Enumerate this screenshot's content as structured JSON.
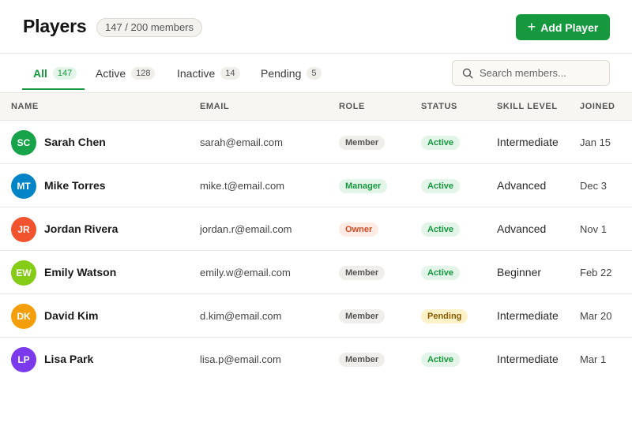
{
  "header": {
    "title": "Players",
    "member_count": "147 / 200 members",
    "add_button": "Add Player"
  },
  "tabs": [
    {
      "label": "All",
      "count": "147",
      "active": true
    },
    {
      "label": "Active",
      "count": "128",
      "active": false
    },
    {
      "label": "Inactive",
      "count": "14",
      "active": false
    },
    {
      "label": "Pending",
      "count": "5",
      "active": false
    }
  ],
  "search": {
    "placeholder": "Search members...",
    "value": ""
  },
  "table": {
    "columns": [
      "NAME",
      "EMAIL",
      "ROLE",
      "STATUS",
      "SKILL LEVEL",
      "JOINED"
    ],
    "rows": [
      {
        "initials": "SC",
        "avatar_color": "#16a34a",
        "name": "Sarah Chen",
        "email": "sarah@email.com",
        "role": "Member",
        "status": "Active",
        "skill": "Intermediate",
        "joined": "Jan 15"
      },
      {
        "initials": "MT",
        "avatar_color": "#0284c7",
        "name": "Mike Torres",
        "email": "mike.t@email.com",
        "role": "Manager",
        "status": "Active",
        "skill": "Advanced",
        "joined": "Dec 3"
      },
      {
        "initials": "JR",
        "avatar_color": "#f0532d",
        "name": "Jordan Rivera",
        "email": "jordan.r@email.com",
        "role": "Owner",
        "status": "Active",
        "skill": "Advanced",
        "joined": "Nov 1"
      },
      {
        "initials": "EW",
        "avatar_color": "#84cc16",
        "name": "Emily Watson",
        "email": "emily.w@email.com",
        "role": "Member",
        "status": "Active",
        "skill": "Beginner",
        "joined": "Feb 22"
      },
      {
        "initials": "DK",
        "avatar_color": "#f59e0b",
        "name": "David Kim",
        "email": "d.kim@email.com",
        "role": "Member",
        "status": "Pending",
        "skill": "Intermediate",
        "joined": "Mar 20"
      },
      {
        "initials": "LP",
        "avatar_color": "#7c3aed",
        "name": "Lisa Park",
        "email": "lisa.p@email.com",
        "role": "Member",
        "status": "Active",
        "skill": "Intermediate",
        "joined": "Mar 1"
      }
    ]
  },
  "colors": {
    "accent": "#16983e",
    "role_member_bg": "#efeeea",
    "role_member_fg": "#555555",
    "role_manager_bg": "#e3f4e8",
    "role_manager_fg": "#16983e",
    "role_owner_bg": "#fdece6",
    "role_owner_fg": "#d9481e",
    "status_active_bg": "#e3f4e8",
    "status_active_fg": "#16983e",
    "status_pending_bg": "#fdf1c7",
    "status_pending_fg": "#8a5a00"
  },
  "icons": {
    "add": "plus-icon",
    "search": "search-icon"
  }
}
